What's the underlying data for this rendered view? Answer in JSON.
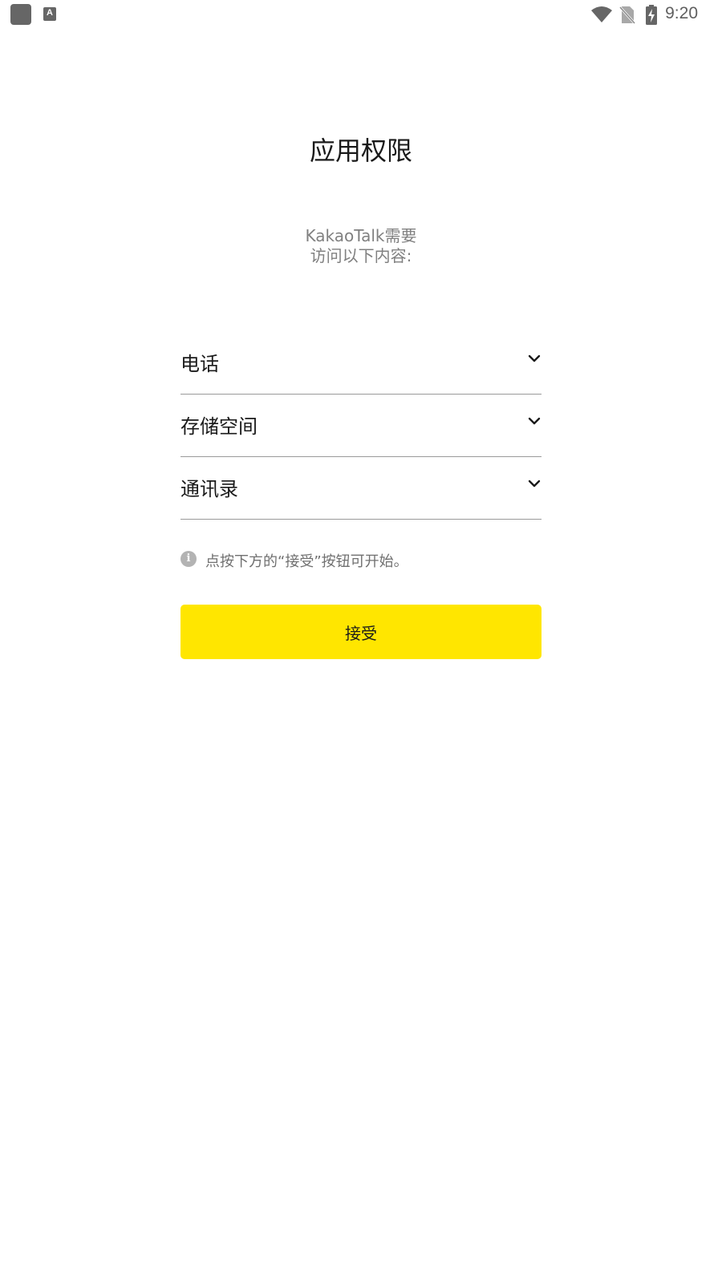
{
  "status_bar": {
    "time": "9:20",
    "left_icons": [
      "app-notification-icon",
      "keyboard-a-icon"
    ],
    "right_icons": [
      "wifi-icon",
      "no-sim-icon",
      "battery-charging-icon"
    ]
  },
  "page": {
    "title": "应用权限",
    "subtitle_line1": "KakaoTalk需要",
    "subtitle_line2": "访问以下内容:"
  },
  "permissions": [
    {
      "label": "电话",
      "icon": "chevron-down-icon"
    },
    {
      "label": "存储空间",
      "icon": "chevron-down-icon"
    },
    {
      "label": "通讯录",
      "icon": "chevron-down-icon"
    }
  ],
  "notice": {
    "icon": "info-icon",
    "icon_glyph": "i",
    "text": "点按下方的“接受”按钮可开始。"
  },
  "accept_button": {
    "label": "接受",
    "color": "#FFE600"
  }
}
